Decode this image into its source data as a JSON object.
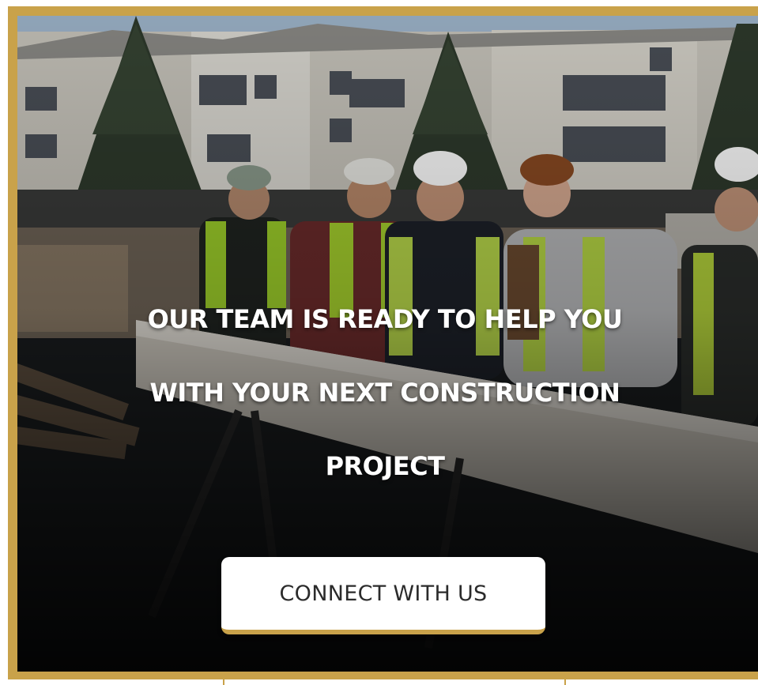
{
  "hero": {
    "image_alt": "Construction crew in hard hats and safety vests standing behind a steel beam in front of an apartment building",
    "headline_lines": [
      "OUR TEAM IS READY TO HELP YOU",
      "WITH YOUR NEXT CONSTRUCTION",
      "PROJECT"
    ],
    "cta_label": "CONNECT WITH US"
  },
  "colors": {
    "accent_gold": "#c9a24a",
    "headline_text": "#ffffff",
    "button_bg": "#ffffff",
    "button_text": "#2b2b2b"
  }
}
